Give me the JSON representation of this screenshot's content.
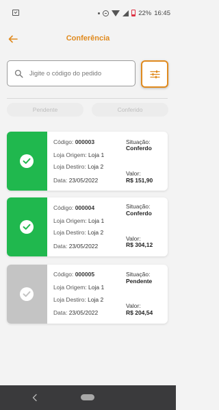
{
  "status_bar": {
    "battery_text": "22%",
    "time": "16:45"
  },
  "app_bar": {
    "title": "Conferência",
    "accent_color": "#e08a1e"
  },
  "search": {
    "placeholder": "Jigite o código do pedido"
  },
  "tabs": [
    {
      "label": "Pendente"
    },
    {
      "label": "Conferido"
    }
  ],
  "orders": [
    {
      "codigo_label": "Código:",
      "codigo": "000003",
      "origem_label": "Loja Origem:",
      "origem": "Loja 1",
      "destino_label": "Loja Destiro:",
      "destino": "Loja 2",
      "data_label": "Data:",
      "data": "23/05/2022",
      "situacao_label": "Situação:",
      "situacao": "Conferdo",
      "valor_label": "Valor:",
      "valor": "R$ 151,90",
      "status_color": "#20b84e"
    },
    {
      "codigo_label": "Código:",
      "codigo": "000004",
      "origem_label": "Loja Origem:",
      "origem": "Loja 1",
      "destino_label": "Loja Destiro:",
      "destino": "Loja 2",
      "data_label": "Data:",
      "data": "23/05/2022",
      "situacao_label": "Situação:",
      "situacao": "Conferdo",
      "valor_label": "Valor:",
      "valor": "R$ 304,12",
      "status_color": "#20b84e"
    },
    {
      "codigo_label": "Código:",
      "codigo": "000005",
      "origem_label": "Loja Origem:",
      "origem": "Loja 1",
      "destino_label": "Loja Destiro:",
      "destino": "Loja 2",
      "data_label": "Data:",
      "data": "23/05/2022",
      "situacao_label": "Situação:",
      "situacao": "Pendente",
      "valor_label": "Valor:",
      "valor": "R$ 204,54",
      "status_color": "#c4c4c4"
    }
  ]
}
